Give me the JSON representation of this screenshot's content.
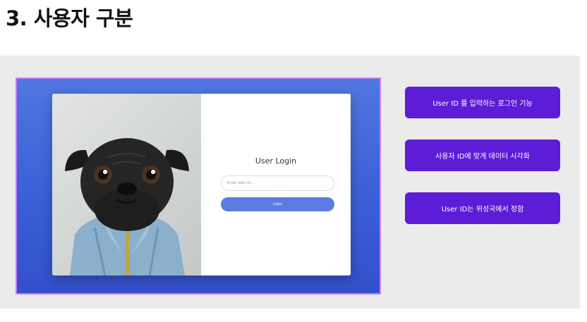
{
  "page": {
    "title": "3. 사용자 구분"
  },
  "login": {
    "title": "User Login",
    "input_placeholder": "Enter User ID...",
    "button_label": "Login"
  },
  "features": [
    {
      "label": "User ID 를 입력하는 로그인 기능"
    },
    {
      "label": "사용자 ID에 맞게 데이터 시각화"
    },
    {
      "label": "User ID는 위성국에서 정함"
    }
  ],
  "colors": {
    "accent_purple": "#5d1cd6",
    "gradient_blue": "#4a6fdc",
    "login_button": "#5b7be0",
    "selection_border": "#c77dff"
  },
  "icons": {
    "photo": "pug-dog-in-denim-jacket"
  }
}
